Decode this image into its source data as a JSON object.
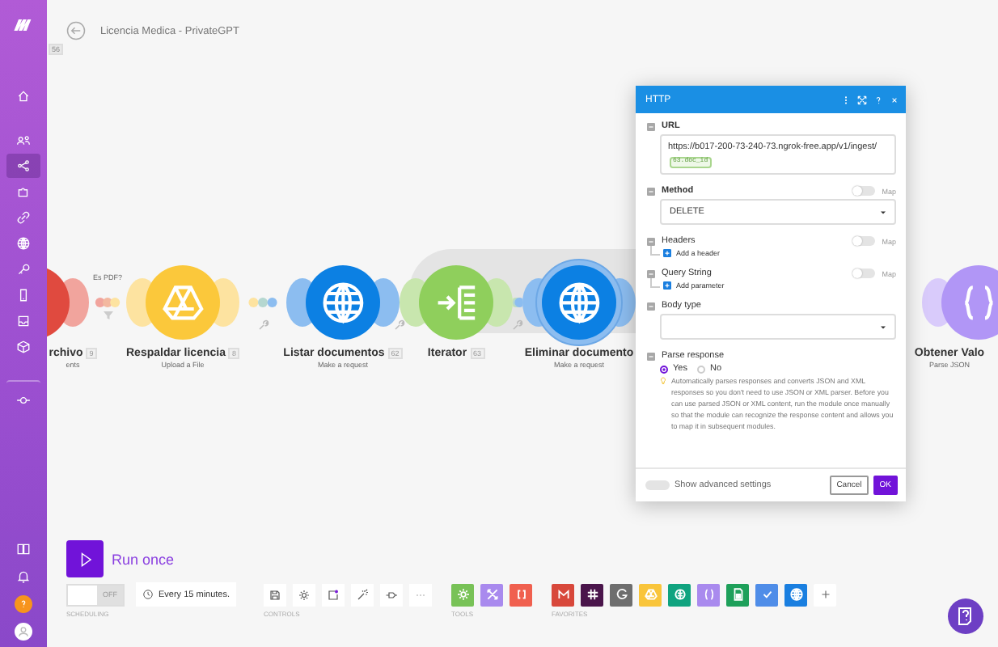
{
  "title": "Licencia Medica - PrivateGPT",
  "canvas_badge": "56",
  "sidebar": {
    "items": [
      {
        "kind": "home",
        "selected": false
      },
      {
        "kind": "users",
        "selected": false
      },
      {
        "kind": "share",
        "selected": true
      },
      {
        "kind": "puzzle",
        "selected": false
      },
      {
        "kind": "link",
        "selected": false
      },
      {
        "kind": "globe",
        "selected": false
      },
      {
        "kind": "key",
        "selected": false
      },
      {
        "kind": "phone",
        "selected": false
      },
      {
        "kind": "inbox",
        "selected": false
      },
      {
        "kind": "box",
        "selected": false
      },
      {
        "kind": "commit",
        "selected": false
      }
    ],
    "bottom_items": [
      {
        "kind": "book"
      },
      {
        "kind": "bell"
      },
      {
        "kind": "help"
      },
      {
        "kind": "avatar"
      }
    ]
  },
  "scenario": {
    "modules": [
      {
        "kind": "app",
        "name": "rchivo",
        "badge": "9",
        "subtitle": "ents",
        "selected": false
      },
      {
        "kind": "drive",
        "name": "Respaldar licencia",
        "badge": "8",
        "subtitle": "Upload a File",
        "selected": false
      },
      {
        "kind": "http",
        "name": "Listar documentos",
        "badge": "62",
        "subtitle": "Make a request",
        "selected": false
      },
      {
        "kind": "iterator",
        "name": "Iterator",
        "badge": "63",
        "selected": false
      },
      {
        "kind": "http",
        "name": "Eliminar documento",
        "subtitle": "Make a request",
        "selected": true
      },
      {
        "kind": "json",
        "name": "Obtener Valo",
        "subtitle": "Parse JSON",
        "selected": false
      }
    ],
    "links": [
      {
        "kind": "filter",
        "label": "Es PDF?"
      },
      {
        "kind": "wrench"
      },
      {
        "kind": "wrench"
      },
      {
        "kind": "wrench"
      }
    ]
  },
  "panel": {
    "title": "HTTP",
    "fields": [
      {
        "kind": "text",
        "label": "URL",
        "required": true,
        "value": "https://b017-200-73-240-73.ngrok-free.app/v1/ingest/",
        "tag": "63.doc_id"
      },
      {
        "kind": "select",
        "label": "Method",
        "required": true,
        "map": "Map",
        "map_on": false,
        "value": "DELETE"
      },
      {
        "kind": "add",
        "label": "Headers",
        "required": false,
        "map": "Map",
        "map_on": false,
        "action": "Add a header"
      },
      {
        "kind": "add",
        "label": "Query String",
        "required": false,
        "map": "Map",
        "map_on": false,
        "action": "Add parameter"
      },
      {
        "kind": "select",
        "label": "Body type",
        "required": false
      },
      {
        "kind": "radio",
        "label": "Parse response",
        "required": false,
        "options": [
          {
            "label": "Yes",
            "selected": true
          },
          {
            "label": "No",
            "selected": false
          }
        ],
        "hint": "Automatically parses responses and converts JSON and XML responses so you don't need to use JSON or XML parser. Before you can use parsed JSON or XML content, run the module once manually so that the module can recognize the response content and allows you to map it in subsequent modules."
      }
    ],
    "advanced": {
      "label": "Show advanced settings",
      "on": false
    },
    "buttons": [
      {
        "kind": "cancel",
        "label": "Cancel"
      },
      {
        "kind": "ok",
        "label": "OK"
      }
    ]
  },
  "run_once": {
    "label": "Run once"
  },
  "scheduling": {
    "on": false,
    "toggle_text": "OFF",
    "interval": "Every 15 minutes.",
    "caption": "SCHEDULING"
  },
  "controls": {
    "caption": "CONTROLS",
    "items": [
      {
        "kind": "save"
      },
      {
        "kind": "gear"
      },
      {
        "kind": "note"
      },
      {
        "kind": "wand"
      },
      {
        "kind": "flow"
      },
      {
        "kind": "more"
      }
    ]
  },
  "tools": {
    "caption": "TOOLS",
    "items": [
      {
        "kind": "gear",
        "color": "#78c257"
      },
      {
        "kind": "cross",
        "color": "#a98aee"
      },
      {
        "kind": "brackets",
        "color": "#f0604f"
      }
    ]
  },
  "favorites": {
    "caption": "FAVORITES",
    "items": [
      {
        "kind": "gmail",
        "color": "#d8483b"
      },
      {
        "kind": "slack",
        "color": "#4a154b"
      },
      {
        "kind": "google",
        "color": "#6e6e6e"
      },
      {
        "kind": "drive",
        "color": "#f9c53b"
      },
      {
        "kind": "openai",
        "color": "#10a37f"
      },
      {
        "kind": "braces",
        "color": "#a98aee"
      },
      {
        "kind": "sheets",
        "color": "#1ea05a"
      },
      {
        "kind": "check",
        "color": "#4f8de8"
      },
      {
        "kind": "globe",
        "color": "#1a7fe0"
      },
      {
        "kind": "plus",
        "color": "#ffffff"
      }
    ]
  }
}
